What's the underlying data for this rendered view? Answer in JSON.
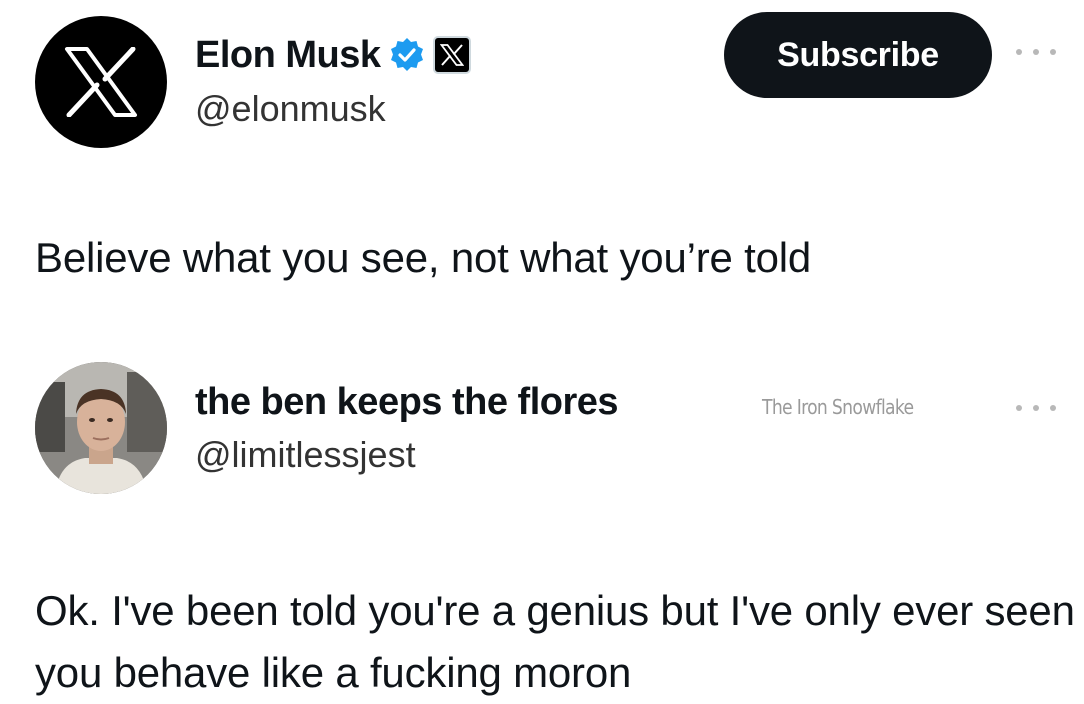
{
  "original_post": {
    "author_name": "Elon Musk",
    "author_handle": "@elonmusk",
    "subscribe_label": "Subscribe",
    "text": "Believe what you see, not what you’re told",
    "avatar_icon": "x-logo-icon",
    "verified_icon": "verified-badge-icon",
    "affiliate_icon": "x-affiliate-badge-icon",
    "colors": {
      "subscribe_bg": "#0f1419",
      "verified_blue": "#1d9bf0"
    }
  },
  "reply_post": {
    "author_name": "the ben keeps the flores",
    "author_handle": "@limitlessjest",
    "text": "Ok. I've been told you're a genius but I've only ever seen you behave like a fucking moron",
    "avatar_icon": "user-avatar"
  },
  "watermark": "The Iron Snowflake",
  "more_icon": "more-options-icon"
}
